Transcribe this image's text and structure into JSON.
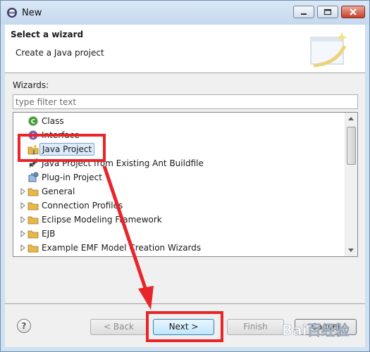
{
  "window": {
    "title": "New",
    "controls": {
      "minimize": "minimize-icon",
      "maximize": "maximize-icon",
      "close": "close-icon"
    }
  },
  "header": {
    "title": "Select a wizard",
    "description": "Create a Java project",
    "banner_icon": "new-wizard-banner-icon"
  },
  "wizards": {
    "label": "Wizards:",
    "filter_placeholder": "type filter text",
    "items": [
      {
        "label": "Class",
        "icon": "java-class-icon",
        "expandable": false
      },
      {
        "label": "Interface",
        "icon": "java-interface-icon",
        "expandable": false
      },
      {
        "label": "Java Project",
        "icon": "java-project-icon",
        "expandable": false,
        "selected": true
      },
      {
        "label": "Java Project from Existing Ant Buildfile",
        "icon": "ant-project-icon",
        "expandable": false
      },
      {
        "label": "Plug-in Project",
        "icon": "plugin-project-icon",
        "expandable": false
      },
      {
        "label": "General",
        "icon": "folder-icon",
        "expandable": true
      },
      {
        "label": "Connection Profiles",
        "icon": "folder-icon",
        "expandable": true
      },
      {
        "label": "Eclipse Modeling Framework",
        "icon": "folder-icon",
        "expandable": true
      },
      {
        "label": "EJB",
        "icon": "folder-icon",
        "expandable": true
      },
      {
        "label": "Example EMF Model Creation Wizards",
        "icon": "folder-icon",
        "expandable": true
      }
    ]
  },
  "footer": {
    "help_label": "?",
    "back_label": "< Back",
    "next_label": "Next >",
    "finish_label": "Finish",
    "cancel_label": "Cancel"
  },
  "watermark": {
    "text": "Bai百经验"
  },
  "colors": {
    "annotation": "#e8252a",
    "accent": "#3c7fb1",
    "selection": "#dcebfc",
    "folder": "#e6b84a"
  }
}
